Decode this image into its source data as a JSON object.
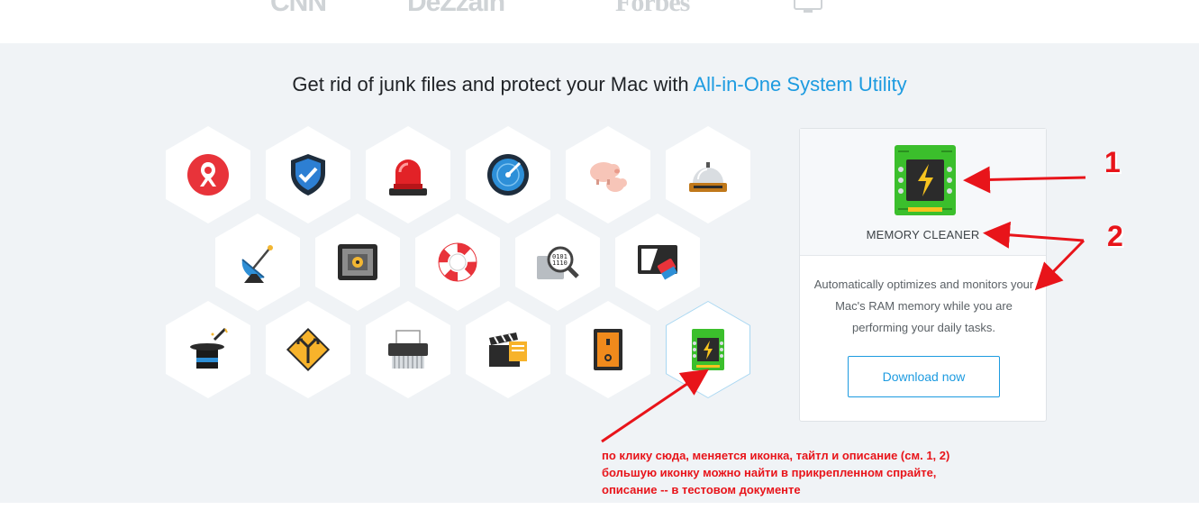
{
  "logos": [
    "CNN",
    "DeZzain",
    "Forbes"
  ],
  "headline": {
    "text": "Get rid of junk files and protect your Mac with ",
    "accent": "All-in-One System Utility"
  },
  "apps": [
    {
      "icon": "anti-theft-icon"
    },
    {
      "icon": "shield-check-icon"
    },
    {
      "icon": "siren-alarm-icon"
    },
    {
      "icon": "radar-scan-icon"
    },
    {
      "icon": "pigs-duplicates-icon"
    },
    {
      "icon": "service-bell-icon"
    },
    {
      "icon": "satellite-dish-icon"
    },
    {
      "icon": "safe-vault-icon"
    },
    {
      "icon": "lifebuoy-icon"
    },
    {
      "icon": "binary-magnifier-icon"
    },
    {
      "icon": "screen-eraser-icon"
    },
    {
      "icon": "magic-hat-icon"
    },
    {
      "icon": "road-sign-icon"
    },
    {
      "icon": "shredder-icon"
    },
    {
      "icon": "clapperboard-files-icon"
    },
    {
      "icon": "power-switch-icon"
    },
    {
      "icon": "memory-chip-icon"
    }
  ],
  "card": {
    "title": "MEMORY CLEANER",
    "description": "Automatically optimizes and monitors your Mac's RAM memory while you are performing your daily tasks.",
    "button": "Download now"
  },
  "annotations": {
    "label1": "1",
    "label2": "2",
    "note_lines": [
      "по клику сюда, меняется иконка, тайтл и описание (см. 1, 2)",
      " большую иконку можно найти в прикрепленном спрайте,",
      " описание -- в тестовом документе"
    ]
  },
  "colors": {
    "accent": "#1d9be0",
    "annotation": "#e8141a",
    "section_bg": "#f0f3f6"
  }
}
